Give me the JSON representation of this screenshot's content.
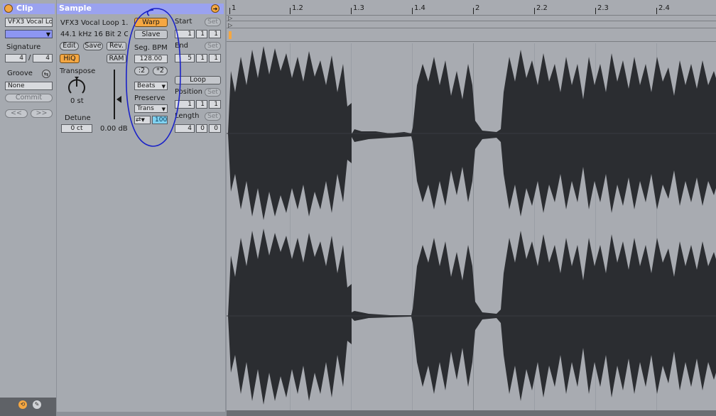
{
  "clip": {
    "title": "Clip",
    "name": "VFX3 Vocal Lo",
    "signature_label": "Signature",
    "sig_num": "4",
    "sig_sep": "/",
    "sig_den": "4",
    "groove_label": "Groove",
    "groove_value": "None",
    "commit_label": "Commit",
    "prev_label": "<<",
    "next_label": ">>"
  },
  "sample": {
    "title": "Sample",
    "filename": "VFX3 Vocal Loop 1.",
    "info": "44.1 kHz 16 Bit 2 Ch",
    "edit_label": "Edit",
    "save_label": "Save",
    "rev_label": "Rev.",
    "hiq_label": "HiQ",
    "ram_label": "RAM",
    "transpose_label": "Transpose",
    "transpose_value": "0 st",
    "detune_label": "Detune",
    "detune_value": "0 ct",
    "gain_value": "0.00 dB"
  },
  "warp": {
    "warp_label": "Warp",
    "slave_label": "Slave",
    "segbpm_label": "Seg. BPM",
    "segbpm_value": "128.00",
    "half_label": ":2",
    "double_label": "*2",
    "mode_value": "Beats",
    "preserve_label": "Preserve",
    "preserve_value": "Trans",
    "loop_icon": "loop-mode-icon",
    "percent_value": "100"
  },
  "markers": {
    "start_label": "Start",
    "start_values": [
      "1",
      "1",
      "1"
    ],
    "end_label": "End",
    "end_values": [
      "5",
      "1",
      "1"
    ],
    "loop_label": "Loop",
    "position_label": "Position",
    "position_values": [
      "1",
      "1",
      "1"
    ],
    "length_label": "Length",
    "length_values": [
      "4",
      "0",
      "0"
    ],
    "set_label": "Set"
  },
  "timeline": {
    "ticks": [
      "1",
      "1.2",
      "1.3",
      "1.4",
      "2",
      "2.2",
      "2.3",
      "2.4"
    ]
  },
  "colors": {
    "header": "#9aa2f0",
    "warp_on": "#f5a742",
    "waveform": "#2b2d31",
    "annotation": "#1a22c8"
  }
}
